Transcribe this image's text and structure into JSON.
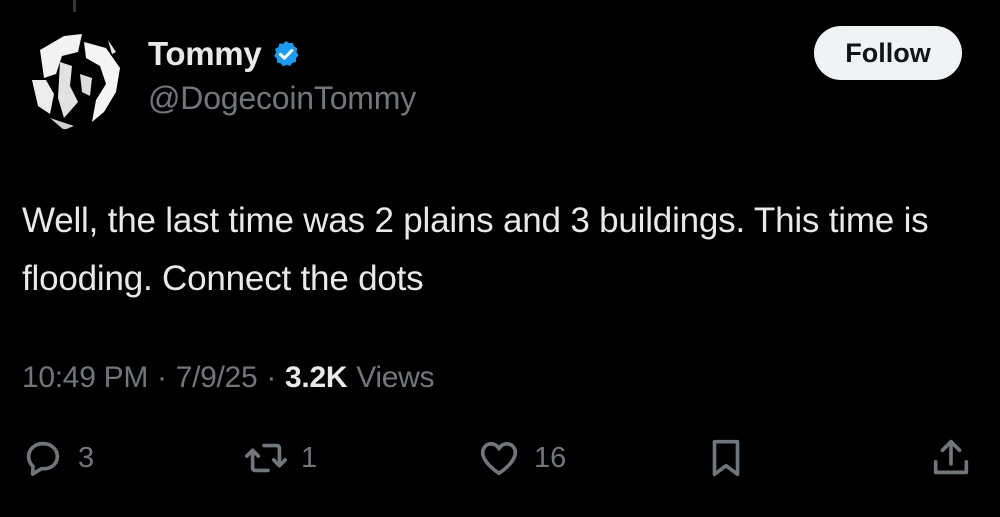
{
  "author": {
    "display_name": "Tommy",
    "handle": "@DogecoinTommy",
    "verified": true
  },
  "follow_button": {
    "label": "Follow"
  },
  "tweet": {
    "text": "Well, the last time was 2 plains and 3 buildings. This time is flooding. Connect the dots"
  },
  "meta": {
    "time": "10:49 PM",
    "separator": "·",
    "date": "7/9/25",
    "views_count": "3.2K",
    "views_label": "Views"
  },
  "actions": {
    "replies": "3",
    "reposts": "1",
    "likes": "16"
  },
  "icons": {
    "reply": "reply-icon",
    "repost": "repost-icon",
    "like": "heart-icon",
    "bookmark": "bookmark-icon",
    "share": "share-icon",
    "verified": "verified-badge-icon"
  },
  "colors": {
    "background": "#000000",
    "text_primary": "#e7e9ea",
    "text_secondary": "#71767b",
    "verified_blue": "#1d9bf0",
    "follow_bg": "#eff3f4"
  }
}
